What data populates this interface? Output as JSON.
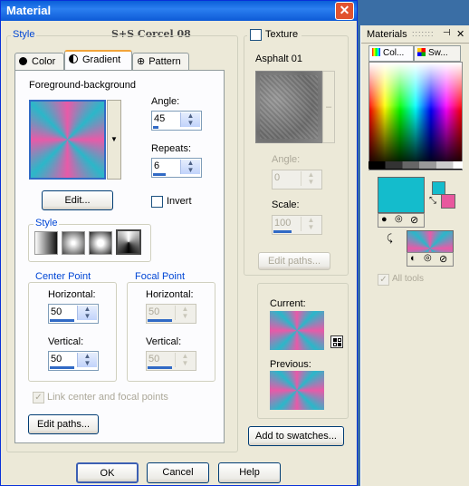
{
  "dialog": {
    "title": "Material",
    "close_glyph": "✕",
    "watermark": "S+S Corcel 08"
  },
  "style_group": {
    "label": "Style",
    "tabs": [
      {
        "label": "Color",
        "icon": "circle-icon"
      },
      {
        "label": "Gradient",
        "icon": "gradient-icon"
      },
      {
        "label": "Pattern",
        "icon": "pattern-icon"
      }
    ],
    "gradient_name": "Foreground-background",
    "angle_label": "Angle:",
    "angle_value": "45",
    "repeats_label": "Repeats:",
    "repeats_value": "6",
    "edit_button": "Edit...",
    "invert_label": "Invert",
    "style_sub_label": "Style",
    "center_point": {
      "label": "Center Point",
      "horizontal_label": "Horizontal:",
      "horizontal_value": "50",
      "vertical_label": "Vertical:",
      "vertical_value": "50"
    },
    "focal_point": {
      "label": "Focal Point",
      "horizontal_label": "Horizontal:",
      "horizontal_value": "50",
      "vertical_label": "Vertical:",
      "vertical_value": "50"
    },
    "link_label": "Link center and focal points",
    "edit_paths_button": "Edit paths..."
  },
  "texture_group": {
    "label": "Texture",
    "name": "Asphalt 01",
    "angle_label": "Angle:",
    "angle_value": "0",
    "scale_label": "Scale:",
    "scale_value": "100",
    "edit_paths_button": "Edit paths..."
  },
  "preview": {
    "current_label": "Current:",
    "previous_label": "Previous:",
    "add_swatches_button": "Add to swatches..."
  },
  "footer": {
    "ok": "OK",
    "cancel": "Cancel",
    "help": "Help"
  },
  "materials_palette": {
    "title": "Materials",
    "tabs": [
      "Col...",
      "Sw..."
    ],
    "all_tools_label": "All tools",
    "foreground_color": "#14bccc",
    "background_color": "#e8589e"
  }
}
